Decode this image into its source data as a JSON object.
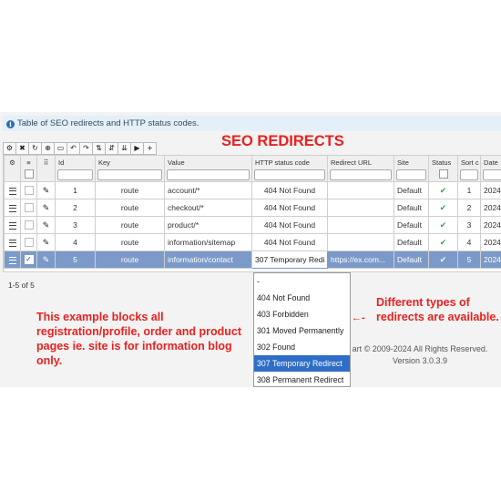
{
  "info_text": "Table of SEO redirects and HTTP status codes.",
  "title": "SEO REDIRECTS",
  "toolbar": [
    "gear-icon",
    "collapse-icon",
    "refresh-icon",
    "add-circle-icon",
    "form-icon",
    "undo-icon",
    "redo-icon",
    "sort-icon",
    "filter-icon",
    "columns-icon",
    "export-icon",
    "plus-icon"
  ],
  "toolbar_glyphs": [
    "⚙",
    "✖",
    "↻",
    "⊕",
    "▭",
    "↶",
    "↷",
    "⇅",
    "⇵",
    "⇊",
    "▶",
    "+"
  ],
  "columns": {
    "id": "Id",
    "key": "Key",
    "value": "Value",
    "code": "HTTP status code",
    "url": "Redirect URL",
    "site": "Site",
    "status": "Status",
    "sort": "Sort c",
    "date": "Date"
  },
  "rows": [
    {
      "id": "1",
      "key": "route",
      "value": "account/*",
      "code": "404 Not Found",
      "url": "",
      "site": "Default",
      "status": "✔",
      "sort": "1",
      "date": "2024"
    },
    {
      "id": "2",
      "key": "route",
      "value": "checkout/*",
      "code": "404 Not Found",
      "url": "",
      "site": "Default",
      "status": "✔",
      "sort": "2",
      "date": "2024"
    },
    {
      "id": "3",
      "key": "route",
      "value": "product/*",
      "code": "404 Not Found",
      "url": "",
      "site": "Default",
      "status": "✔",
      "sort": "3",
      "date": "2024"
    },
    {
      "id": "4",
      "key": "route",
      "value": "information/sitemap",
      "code": "404 Not Found",
      "url": "",
      "site": "Default",
      "status": "✔",
      "sort": "4",
      "date": "2024"
    },
    {
      "id": "5",
      "key": "route",
      "value": "information/contact",
      "code": "307 Temporary Redi",
      "url": "https://ex.com...",
      "site": "Default",
      "status": "✔",
      "sort": "5",
      "date": "2024"
    }
  ],
  "pager": "1-5 of 5",
  "dropdown": {
    "options": [
      "-",
      "404 Not Found",
      "403 Forbidden",
      "301 Moved Permanently",
      "302 Found",
      "307 Temporary Redirect",
      "308 Permanent Redirect"
    ],
    "selected_index": 5
  },
  "copyright": {
    "line1": "art © 2009-2024 All Rights Reserved.",
    "line2": "Version 3.0.3.9"
  },
  "note_left": "This example blocks all registration/profile, order and product pages ie. site is for information blog only.",
  "note_right": "Different types of redirects are available.",
  "colors": {
    "accent": "#e8211f",
    "selected_row": "#7b9ac9",
    "dropdown_active": "#2f6ec7",
    "info_bg": "#e3f0f9"
  }
}
